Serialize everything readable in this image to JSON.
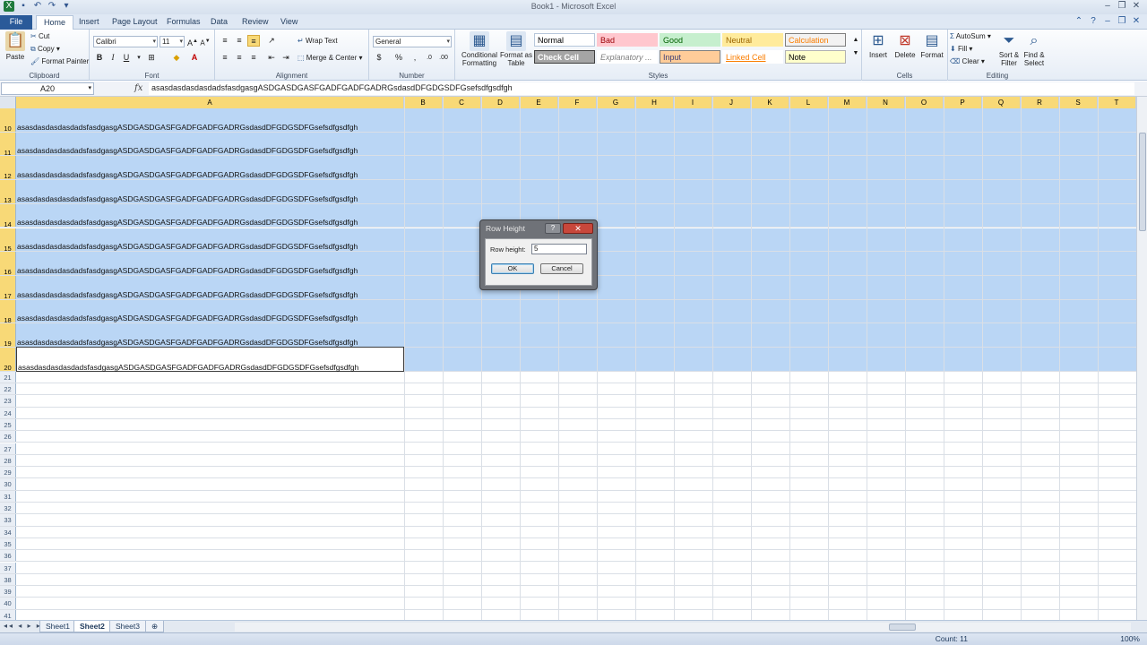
{
  "window": {
    "title": "Book1 - Microsoft Excel",
    "qat_icons": [
      "excel-icon",
      "save-icon",
      "undo-icon",
      "redo-icon",
      "customize-icon"
    ]
  },
  "tabs": {
    "file": "File",
    "items": [
      "Home",
      "Insert",
      "Page Layout",
      "Formulas",
      "Data",
      "Review",
      "View"
    ],
    "active": "Home"
  },
  "ribbon": {
    "clipboard": {
      "label": "Clipboard",
      "paste": "Paste",
      "cut": "Cut",
      "copy": "Copy",
      "format_painter": "Format Painter"
    },
    "font": {
      "label": "Font",
      "family": "Calibri",
      "size": "11",
      "bold": "B",
      "italic": "I",
      "underline": "U"
    },
    "alignment": {
      "label": "Alignment",
      "wrap_text": "Wrap Text",
      "merge_center": "Merge & Center"
    },
    "number": {
      "label": "Number",
      "format": "General",
      "currency": "$",
      "percent": "%",
      "comma": ","
    },
    "styles": {
      "label": "Styles",
      "conditional": "Conditional Formatting",
      "format_table": "Format as Table",
      "cells": [
        {
          "name": "Normal",
          "bg": "#ffffff",
          "fg": "#000000",
          "border": "#b7c7db"
        },
        {
          "name": "Bad",
          "bg": "#ffc7ce",
          "fg": "#9c0006",
          "border": "#ffc7ce"
        },
        {
          "name": "Good",
          "bg": "#c6efce",
          "fg": "#006100",
          "border": "#c6efce"
        },
        {
          "name": "Neutral",
          "bg": "#ffeb9c",
          "fg": "#9c6500",
          "border": "#ffeb9c"
        },
        {
          "name": "Calculation",
          "bg": "#f2f2f2",
          "fg": "#fa7d00",
          "border": "#7f7f7f"
        },
        {
          "name": "Check Cell",
          "bg": "#a5a5a5",
          "fg": "#ffffff",
          "border": "#3f3f3f"
        },
        {
          "name": "Explanatory ...",
          "bg": "#ffffff",
          "fg": "#7f7f7f",
          "border": "#ffffff"
        },
        {
          "name": "Input",
          "bg": "#ffcc99",
          "fg": "#3f3f76",
          "border": "#7f7f7f"
        },
        {
          "name": "Linked Cell",
          "bg": "#ffffff",
          "fg": "#fa7d00",
          "border": "#ffffff"
        },
        {
          "name": "Note",
          "bg": "#ffffcc",
          "fg": "#000000",
          "border": "#b2b2b2"
        }
      ]
    },
    "cells": {
      "label": "Cells",
      "insert": "Insert",
      "delete": "Delete",
      "format": "Format"
    },
    "editing": {
      "label": "Editing",
      "autosum": "AutoSum",
      "fill": "Fill",
      "clear": "Clear",
      "sort_filter": "Sort & Filter",
      "find_select": "Find & Select"
    }
  },
  "formula_bar": {
    "name_box": "A20",
    "fx": "fx",
    "content": "asasdasdasdasdadsfasdgasgASDGASDGASFGADFGADFGADRGsdasdDFGDGSDFGsefsdfgsdfgh"
  },
  "grid": {
    "columns": [
      "A",
      "B",
      "C",
      "D",
      "E",
      "F",
      "G",
      "H",
      "I",
      "J",
      "K",
      "L",
      "M",
      "N",
      "O",
      "P",
      "Q",
      "R",
      "S",
      "T"
    ],
    "selected_rows": [
      "10",
      "11",
      "12",
      "13",
      "14",
      "15",
      "16",
      "17",
      "18",
      "19",
      "20"
    ],
    "plain_rows": [
      "21",
      "22",
      "23",
      "24",
      "25",
      "26",
      "27",
      "28",
      "29",
      "30",
      "31",
      "32",
      "33",
      "34",
      "35",
      "36",
      "37",
      "38",
      "39",
      "40",
      "41"
    ],
    "cell_text": "asasdasdasdasdadsfasdgasgASDGASDGASFGADFGADFGADRGsdasdDFGDGSDFGsefsdfgsdfgh"
  },
  "sheets": {
    "tabs": [
      "Sheet1",
      "Sheet2",
      "Sheet3"
    ],
    "active": "Sheet2"
  },
  "status": {
    "ready": "",
    "count": "Count: 11",
    "zoom": "100%"
  },
  "dialog": {
    "title": "Row Height",
    "help": "?",
    "close": "✕",
    "label": "Row height:",
    "value": "5",
    "ok": "OK",
    "cancel": "Cancel"
  }
}
